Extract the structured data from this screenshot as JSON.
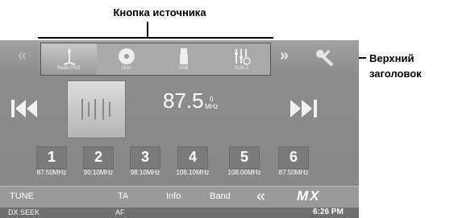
{
  "annotations": {
    "source_button": "Кнопка источника",
    "header_line1": "Верхний",
    "header_line2": "заголовок"
  },
  "top_bar": {
    "left_arrow": "«",
    "right_arrow": "»",
    "settings_icon": "wrench-icon",
    "sources": [
      {
        "label": "Radio FM1",
        "icon": "radio-icon",
        "active": true
      },
      {
        "label": "Disc",
        "icon": "disc-icon",
        "active": false
      },
      {
        "label": "USB",
        "icon": "usb-icon",
        "active": false
      },
      {
        "label": "AUX-1",
        "icon": "aux-icon",
        "active": false
      }
    ]
  },
  "tuner": {
    "frequency": "87.5",
    "unit_top": "0",
    "unit": "MHz",
    "prev_icon": "seek-back-icon",
    "next_icon": "seek-forward-icon"
  },
  "presets": [
    {
      "number": "1",
      "freq": "87.50MHz"
    },
    {
      "number": "2",
      "freq": "90.10MHz"
    },
    {
      "number": "3",
      "freq": "98.10MHz"
    },
    {
      "number": "4",
      "freq": "106.10MHz"
    },
    {
      "number": "5",
      "freq": "108.00MHz"
    },
    {
      "number": "6",
      "freq": "87.50MHz"
    }
  ],
  "bottom_bar": {
    "tune": "TUNE",
    "ta": "TA",
    "info": "Info",
    "band": "Band",
    "back": "«",
    "logo": "MX"
  },
  "status_bar": {
    "seek_mode": "DX SEEK",
    "af": "AF",
    "time": "6:26 PM"
  },
  "colors": {
    "screen": "#8d8d8d",
    "text": "#ffffff",
    "annotation": "#000000"
  }
}
